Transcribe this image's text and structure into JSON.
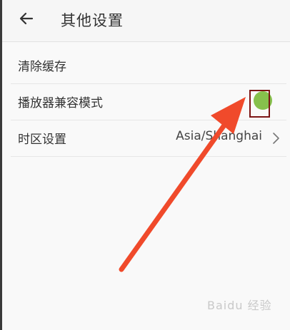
{
  "header": {
    "title": "其他设置",
    "back_icon": "arrow-left-icon"
  },
  "settings": [
    {
      "label": "清除缓存"
    },
    {
      "label": "播放器兼容模式",
      "toggle_on": true
    },
    {
      "label": "时区设置",
      "value": "Asia/Shanghai"
    }
  ],
  "overlay": {
    "annotation": "red-arrow",
    "highlight_color": "#7b1414",
    "arrow_color": "#f04a2b"
  },
  "watermark": "Baidu 经验",
  "colors": {
    "toggle_on": "#86c04c"
  }
}
